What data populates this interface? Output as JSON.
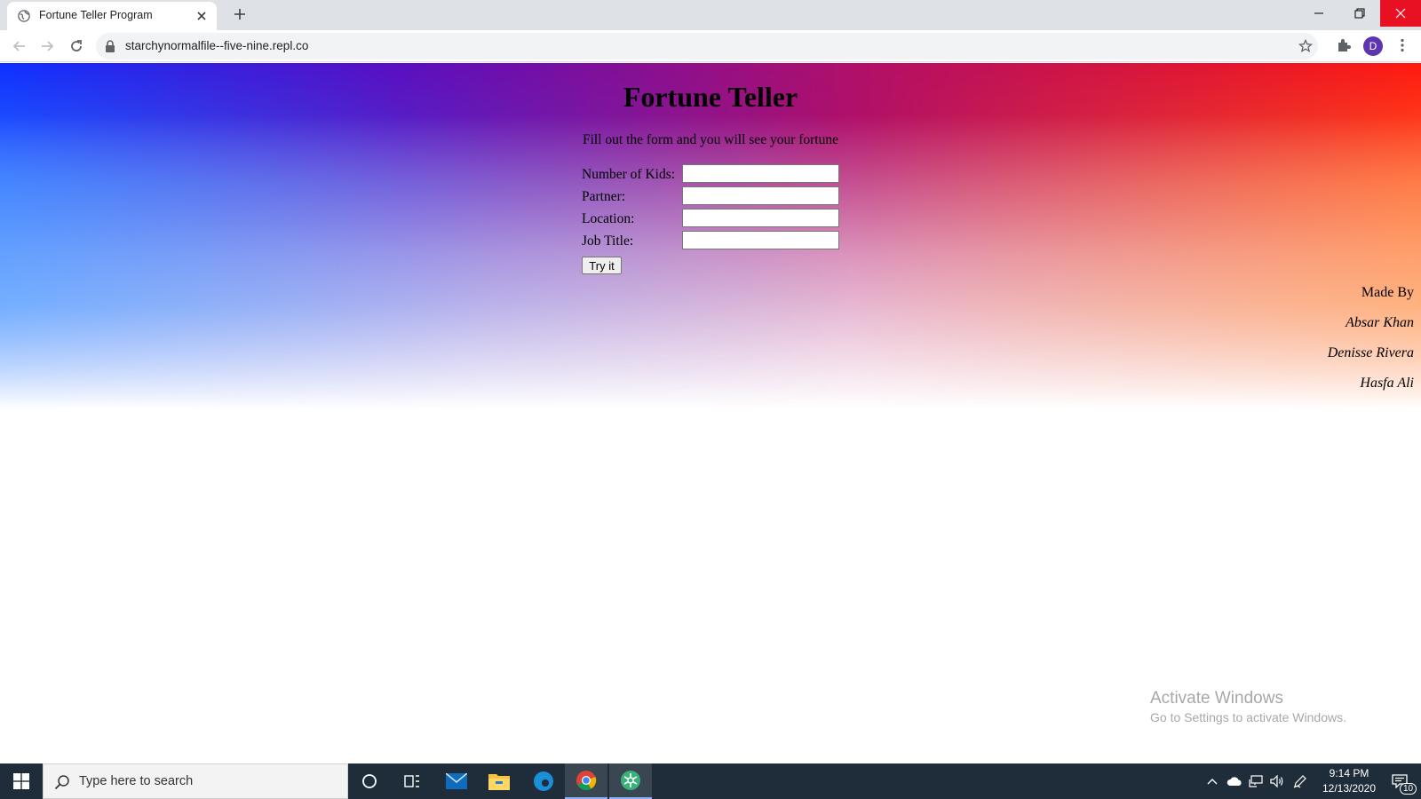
{
  "browser": {
    "tab_title": "Fortune Teller Program",
    "url": "starchynormalfile--five-nine.repl.co",
    "profile_initial": "D"
  },
  "page": {
    "heading": "Fortune Teller",
    "subtitle": "Fill out the form and you will see your fortune",
    "form": {
      "fields": [
        {
          "label": "Number of Kids:",
          "value": ""
        },
        {
          "label": "Partner:",
          "value": ""
        },
        {
          "label": "Location:",
          "value": ""
        },
        {
          "label": "Job Title:",
          "value": ""
        }
      ],
      "submit_label": "Try it"
    },
    "credits": {
      "title": "Made By",
      "names": [
        "Absar Khan",
        "Denisse Rivera",
        "Hasfa Ali"
      ]
    },
    "gradient_colors": [
      "#1030ff",
      "#5a0fc0",
      "#b0106a",
      "#ff1a10"
    ]
  },
  "watermark": {
    "title": "Activate Windows",
    "subtitle": "Go to Settings to activate Windows."
  },
  "taskbar": {
    "search_placeholder": "Type here to search",
    "pinned": [
      "cortana-icon",
      "task-view-icon",
      "mail-icon",
      "file-explorer-icon",
      "edge-icon",
      "chrome-icon",
      "replit-app-icon"
    ],
    "clock_time": "9:14 PM",
    "clock_date": "12/13/2020",
    "notification_count": "10"
  }
}
